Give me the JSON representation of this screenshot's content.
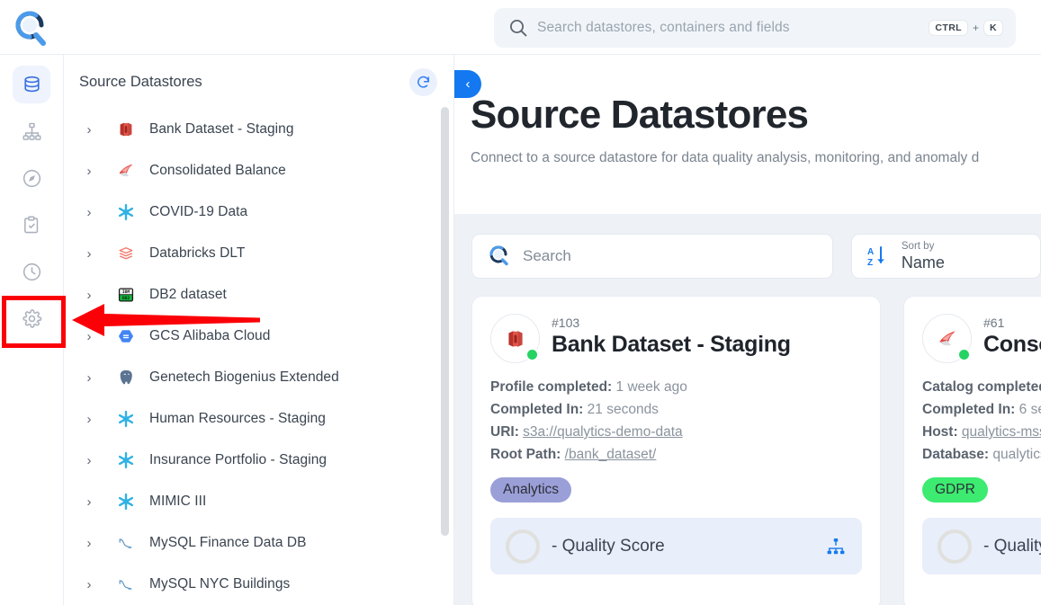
{
  "topbar": {
    "logo_icon": "qualytics-magnifier-logo",
    "search": {
      "placeholder": "Search datastores, containers and fields",
      "value": "",
      "icon": "search-icon",
      "shortcut_key": "CTRL",
      "shortcut_plus": "+",
      "shortcut_key2": "K"
    }
  },
  "rail": {
    "items": [
      {
        "name": "datastores",
        "icon": "database-icon",
        "active": true
      },
      {
        "name": "containers",
        "icon": "hierarchy-icon",
        "active": false
      },
      {
        "name": "explore",
        "icon": "compass-icon",
        "active": false
      },
      {
        "name": "checks",
        "icon": "clipboard-check-icon",
        "active": false
      },
      {
        "name": "history",
        "icon": "clock-icon",
        "active": false
      },
      {
        "name": "settings",
        "icon": "gear-icon",
        "active": false
      }
    ]
  },
  "tree": {
    "title": "Source Datastores",
    "refresh_icon": "refresh-icon",
    "collapse_icon": "chevron-left-icon",
    "items": [
      {
        "label": "Bank Dataset - Staging",
        "icon": "aws-s3-icon"
      },
      {
        "label": "Consolidated Balance",
        "icon": "mssql-icon"
      },
      {
        "label": "COVID-19 Data",
        "icon": "snowflake-icon"
      },
      {
        "label": "Databricks DLT",
        "icon": "databricks-icon"
      },
      {
        "label": "DB2 dataset",
        "icon": "ibm-db2-icon"
      },
      {
        "label": "GCS Alibaba Cloud",
        "icon": "gcs-icon"
      },
      {
        "label": "Genetech Biogenius Extended",
        "icon": "postgresql-icon"
      },
      {
        "label": "Human Resources - Staging",
        "icon": "snowflake-icon"
      },
      {
        "label": "Insurance Portfolio - Staging",
        "icon": "snowflake-icon"
      },
      {
        "label": "MIMIC III",
        "icon": "snowflake-icon"
      },
      {
        "label": "MySQL Finance Data DB",
        "icon": "mysql-icon"
      },
      {
        "label": "MySQL NYC Buildings",
        "icon": "mysql-icon"
      }
    ]
  },
  "main": {
    "title": "Source Datastores",
    "subtitle": "Connect to a source datastore for data quality analysis, monitoring, and anomaly d",
    "search": {
      "placeholder": "Search",
      "value": "",
      "icon": "search-icon"
    },
    "sort": {
      "icon": "sort-az-icon",
      "label": "Sort by",
      "value": "Name"
    },
    "cards": [
      {
        "id": "#103",
        "name": "Bank Dataset - Staging",
        "icon": "aws-s3-icon",
        "status": "online",
        "status_color": "#26d363",
        "meta": [
          {
            "key": "Profile completed:",
            "value": "1 week ago",
            "link": false
          },
          {
            "key": "Completed In:",
            "value": "21 seconds",
            "link": false
          },
          {
            "key": "URI:",
            "value": "s3a://qualytics-demo-data",
            "link": true
          },
          {
            "key": "Root Path:",
            "value": "/bank_dataset/",
            "link": true
          }
        ],
        "tags": [
          {
            "label": "Analytics",
            "color": "#9b9fd8"
          }
        ],
        "quality": {
          "value": "-",
          "label": "Quality Score",
          "icon": "hierarchy-icon"
        }
      },
      {
        "id": "#61",
        "name": "Consoli",
        "icon": "mssql-icon",
        "status": "online",
        "status_color": "#26d363",
        "meta": [
          {
            "key": "Catalog completed:",
            "value": "",
            "link": false
          },
          {
            "key": "Completed In:",
            "value": "6 sec",
            "link": false
          },
          {
            "key": "Host:",
            "value": "qualytics-mss",
            "link": true
          },
          {
            "key": "Database:",
            "value": "qualytics",
            "link": false
          }
        ],
        "tags": [
          {
            "label": "GDPR",
            "color": "#3ceb70"
          }
        ],
        "quality": {
          "value": "-",
          "label": "Quality S",
          "icon": "hierarchy-icon"
        }
      }
    ]
  },
  "annotation": {
    "highlight_target": "settings-rail-item",
    "box_color": "#fb0007",
    "arrow_color": "#fb0007",
    "arrow_direction": "left"
  }
}
